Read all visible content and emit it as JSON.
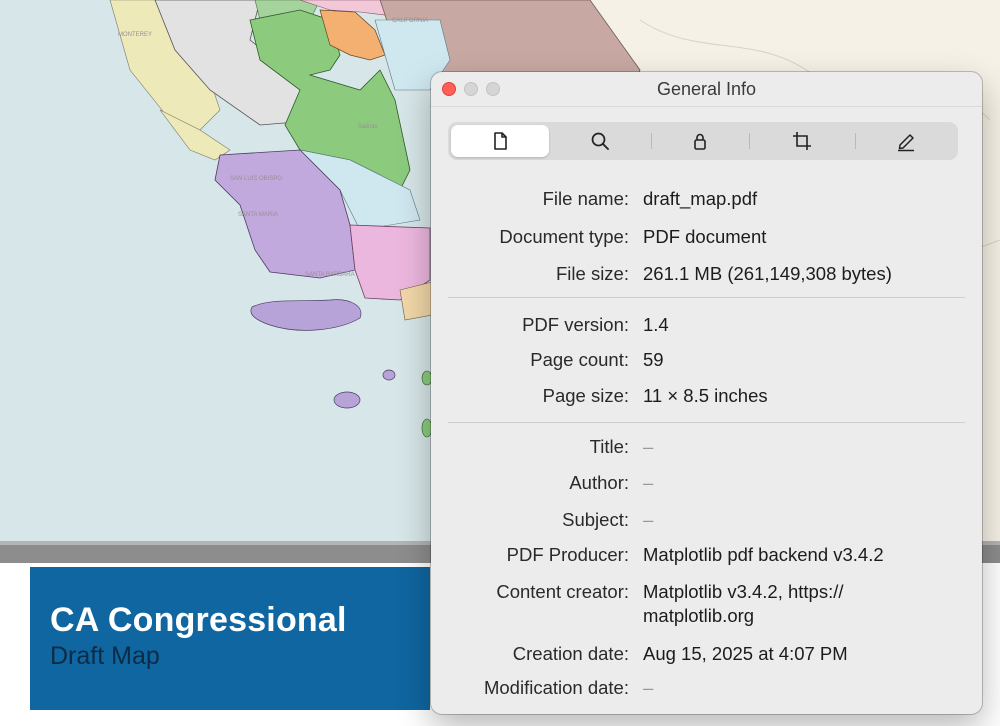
{
  "map": {
    "labels": [
      "MONTEREY",
      "CALIFORNIA",
      "SAN LUIS OBISPO",
      "SANTA MARIA",
      "SANTA BARBARA",
      "Salinas"
    ],
    "banner_title": "CA Congressional",
    "banner_subtitle": "Draft Map"
  },
  "window": {
    "title": "General Info",
    "toolbar": [
      "document-icon",
      "magnifier-icon",
      "lock-icon",
      "crop-icon",
      "pencil-icon"
    ],
    "active_tab": "document-icon"
  },
  "info": {
    "file_name": {
      "label": "File name:",
      "value": "draft_map.pdf"
    },
    "document_type": {
      "label": "Document type:",
      "value": "PDF document"
    },
    "file_size": {
      "label": "File size:",
      "value": "261.1 MB (261,149,308 bytes)"
    },
    "pdf_version": {
      "label": "PDF version:",
      "value": "1.4"
    },
    "page_count": {
      "label": "Page count:",
      "value": "59"
    },
    "page_size": {
      "label": "Page size:",
      "value": "11 × 8.5 inches"
    },
    "title": {
      "label": "Title:",
      "value": "–"
    },
    "author": {
      "label": "Author:",
      "value": "–"
    },
    "subject": {
      "label": "Subject:",
      "value": "–"
    },
    "pdf_producer": {
      "label": "PDF Producer:",
      "value": "Matplotlib pdf backend v3.4.2"
    },
    "content_creator": {
      "label": "Content creator:",
      "value": "Matplotlib v3.4.2, https:// matplotlib.org"
    },
    "creation_date": {
      "label": "Creation date:",
      "value": "Aug 15, 2025 at 4:07 PM"
    },
    "modification_date": {
      "label": "Modification date:",
      "value": "–"
    }
  },
  "colors": {
    "ocean": "#d7e6e8",
    "banner": "#0f66a0",
    "close": "#ff5f57"
  }
}
